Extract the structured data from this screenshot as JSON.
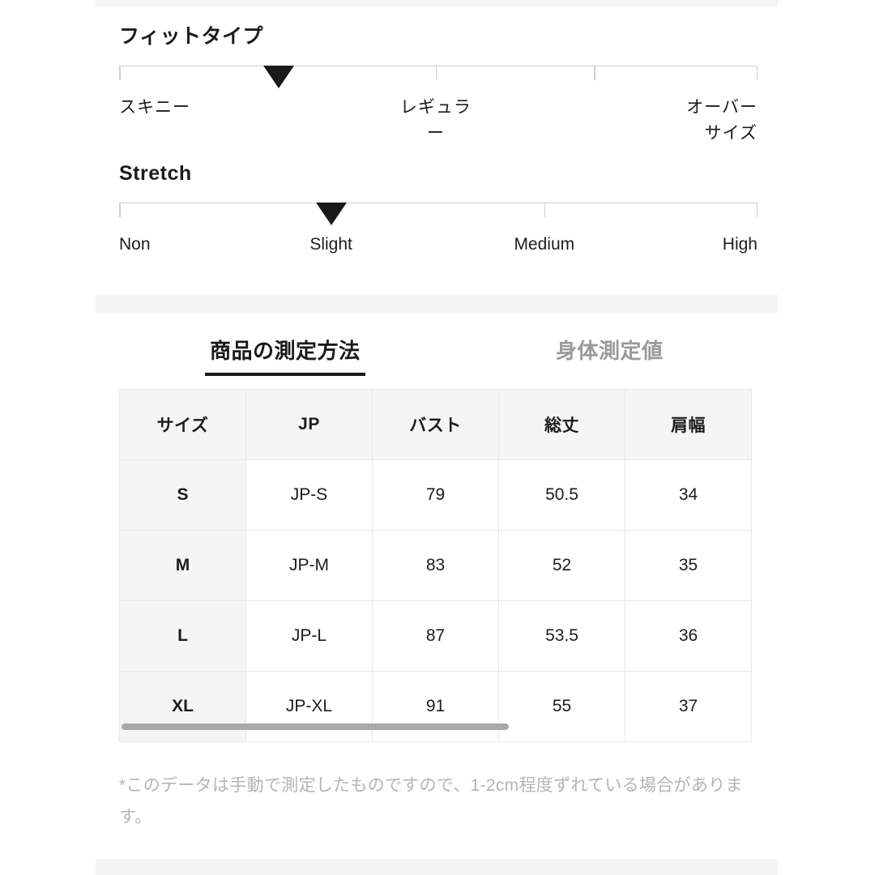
{
  "bands": {
    "accent_color": "#f4f4f4"
  },
  "fit_type": {
    "title": "フィットタイプ",
    "marker_position_pct": 25,
    "ticks_pct": [
      0,
      49.6,
      74.4,
      100
    ],
    "labels": [
      {
        "text": "スキニー",
        "align": "left"
      },
      {
        "text": "レギュラー",
        "align": "center"
      },
      {
        "text": "オーバーサイズ",
        "align": "right"
      }
    ]
  },
  "stretch": {
    "title": "Stretch",
    "marker_position_pct": 33.2,
    "ticks_pct": [
      0,
      33.2,
      66.6,
      100
    ],
    "labels": [
      {
        "text": "Non",
        "align": "left"
      },
      {
        "text": "Slight",
        "align": "center"
      },
      {
        "text": "Medium",
        "align": "center"
      },
      {
        "text": "High",
        "align": "right"
      }
    ]
  },
  "tabs": {
    "active_label": "商品の測定方法",
    "inactive_label": "身体測定値",
    "active_index": 0
  },
  "size_table": {
    "columns": [
      "サイズ",
      "JP",
      "バスト",
      "総丈",
      "肩幅"
    ],
    "rows": [
      [
        "S",
        "JP-S",
        "79",
        "50.5",
        "34"
      ],
      [
        "M",
        "JP-M",
        "83",
        "52",
        "35"
      ],
      [
        "L",
        "JP-L",
        "87",
        "53.5",
        "36"
      ],
      [
        "XL",
        "JP-XL",
        "91",
        "55",
        "37"
      ]
    ],
    "scroll_thumb_pct": 61
  },
  "footnote": {
    "text": "*このデータは手動で測定したものですので、1-2cm程度ずれている場合があります。"
  }
}
